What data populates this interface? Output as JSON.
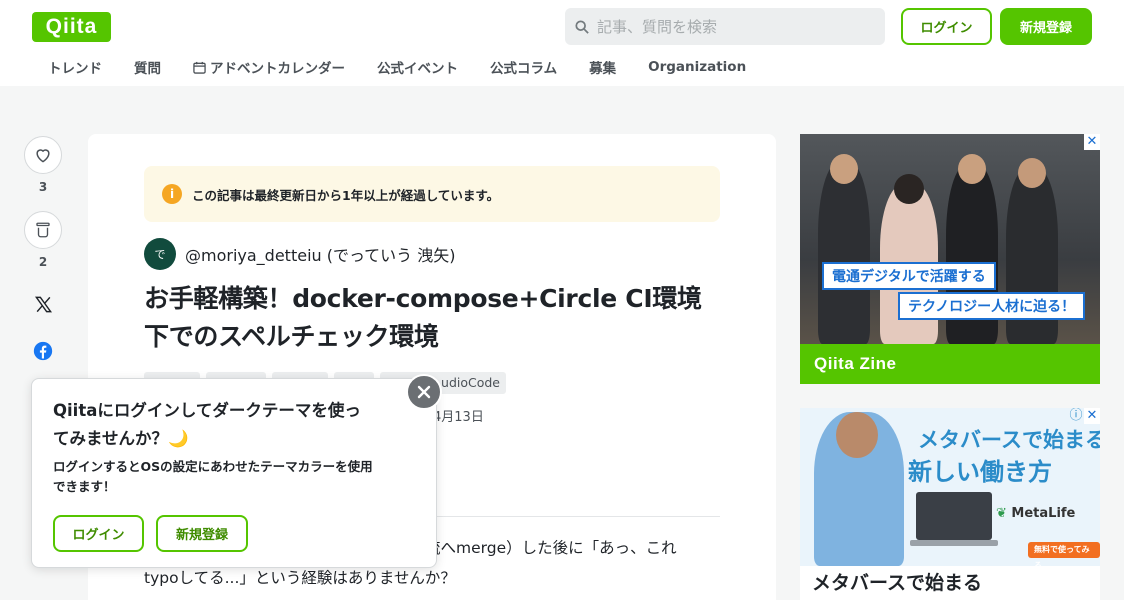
{
  "header": {
    "logo": "Qiita",
    "search_placeholder": "記事、質問を検索",
    "login_label": "ログイン",
    "signup_label": "新規登録",
    "nav": [
      "トレンド",
      "質問",
      "アドベントカレンダー",
      "公式イベント",
      "公式コラム",
      "募集",
      "Organization"
    ]
  },
  "actions": {
    "like_count": "3",
    "stock_count": "2"
  },
  "article": {
    "notice": "この記事は最終更新日から1年以上が経過しています。",
    "avatar_text": "で",
    "author": "@moriya_detteiu (でっていう 洩矢)",
    "title_line1": "お手軽構築！docker-compose+Circle CI環境",
    "title_line2": "下でのスペルチェック環境",
    "tag_visible": "udioCode",
    "date": "4月13日",
    "body_line1": "流へmerge）した後に「あっ、これ",
    "body_line2": "typoしてる...」という経験はありませんか？"
  },
  "popup": {
    "title_line1": "Qiitaにログインしてダークテーマを使っ",
    "title_line2": "てみませんか？🌙",
    "desc_line1": "ログインするとOSの設定にあわせたテーマカラーを使用",
    "desc_line2": "できます！",
    "login_label": "ログイン",
    "signup_label": "新規登録"
  },
  "ads": {
    "ad1_banner1": "電通デジタルで活躍する",
    "ad1_banner2": "テクノロジー人材に迫る！",
    "ad1_footer": "Qiita Zine",
    "ad2_title1": "メタバースで始まる",
    "ad2_title2": "新しい働き方",
    "ad2_brand": "MetaLife",
    "ad2_cta": "無料で使ってみる",
    "ad2_bottom": "メタバースで始まる"
  },
  "colors": {
    "brand": "#55c500",
    "brand_text": "#3f8c00",
    "notice_bg": "#fdf8e5"
  }
}
